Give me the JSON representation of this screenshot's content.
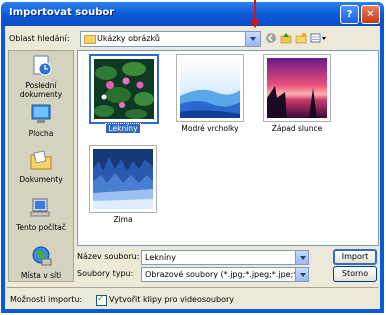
{
  "window": {
    "title": "Importovat soubor",
    "help_label": "?",
    "close_label": "✕"
  },
  "lookin": {
    "label": "Oblast hledání:",
    "value": "Ukázky obrázků"
  },
  "places": [
    {
      "label": "Poslední dokumenty",
      "icon": "recent-documents-icon"
    },
    {
      "label": "Plocha",
      "icon": "desktop-icon"
    },
    {
      "label": "Dokumenty",
      "icon": "documents-icon"
    },
    {
      "label": "Tento počítač",
      "icon": "computer-icon"
    },
    {
      "label": "Místa v síti",
      "icon": "network-icon"
    }
  ],
  "files": [
    {
      "name": "Lekníny",
      "selected": true
    },
    {
      "name": "Modré vrcholky",
      "selected": false
    },
    {
      "name": "Západ slunce",
      "selected": false
    },
    {
      "name": "Zima",
      "selected": false
    }
  ],
  "filename": {
    "label": "Název souboru:",
    "value": "Lekníny"
  },
  "filetype": {
    "label": "Soubory typu:",
    "value": "Obrazové soubory (*.jpg;*.jpeg;*.jpe;*.jfif;*.gif;*.p"
  },
  "buttons": {
    "import": "Import",
    "cancel": "Storno"
  },
  "options": {
    "label": "Možnosti importu:",
    "checkbox_label": "Vytvořit klipy pro videosoubory",
    "checked": true
  }
}
